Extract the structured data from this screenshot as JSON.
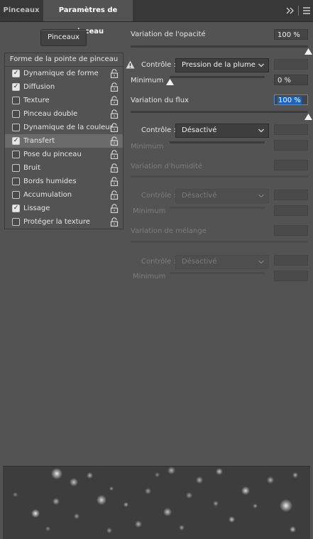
{
  "tabs": [
    {
      "label": "Pinceaux",
      "active": false
    },
    {
      "label": "Paramètres de pinceau",
      "active": true
    }
  ],
  "panel_icons": {
    "expand": "double-chevron-right-icon",
    "menu": "hamburger-menu-icon"
  },
  "brushes_button": "Pinceaux",
  "list": {
    "header": "Forme de la pointe de pinceau",
    "items": [
      {
        "label": "Dynamique de forme",
        "checked": true
      },
      {
        "label": "Diffusion",
        "checked": true
      },
      {
        "label": "Texture",
        "checked": false
      },
      {
        "label": "Pinceau double",
        "checked": false
      },
      {
        "label": "Dynamique de la couleur",
        "checked": false
      },
      {
        "label": "Transfert",
        "checked": true,
        "selected": true
      },
      {
        "label": "Pose du pinceau",
        "checked": false
      },
      {
        "label": "Bruit",
        "checked": false
      },
      {
        "label": "Bords humides",
        "checked": false
      },
      {
        "label": "Accumulation",
        "checked": false
      },
      {
        "label": "Lissage",
        "checked": true
      },
      {
        "label": "Protéger la texture",
        "checked": false
      }
    ]
  },
  "settings": {
    "opacity": {
      "label": "Variation de l'opacité",
      "value": "100 %",
      "control_label": "Contrôle :",
      "control_value": "Pression de la plume",
      "minimum_label": "Minimum",
      "minimum_value": "0 %"
    },
    "flow": {
      "label": "Variation du flux",
      "value": "100 %",
      "control_label": "Contrôle :",
      "control_value": "Désactivé",
      "minimum_label": "Minimum"
    },
    "humidity": {
      "label": "Variation d'humidité",
      "control_label": "Contrôle :",
      "control_value": "Désactivé",
      "minimum_label": "Minimum"
    },
    "mix": {
      "label": "Variation de mélange",
      "control_label": "Contrôle :",
      "control_value": "Désactivé",
      "minimum_label": "Minimum"
    }
  },
  "colors": {
    "panel_bg": "#535353",
    "tab_bg": "#383838",
    "selection_blue": "#1d63b8"
  }
}
